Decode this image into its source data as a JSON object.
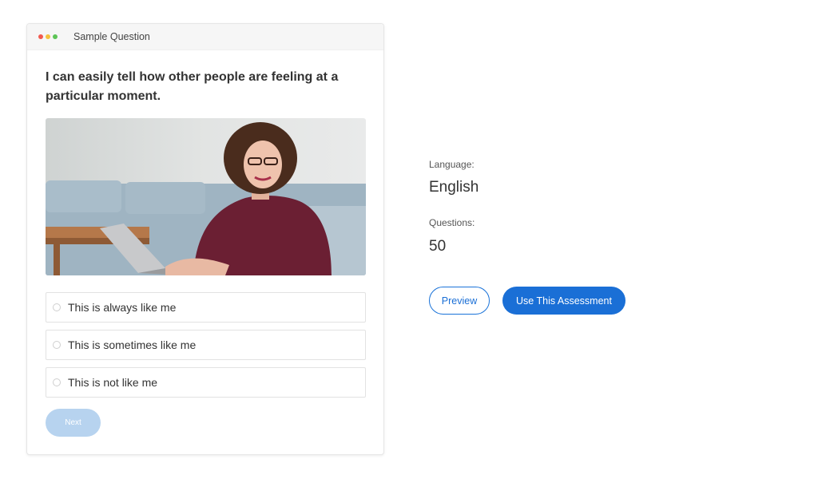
{
  "window": {
    "title": "Sample Question",
    "dot_colors": [
      "#f25a4f",
      "#f5c23e",
      "#5cc456"
    ]
  },
  "question": {
    "text": "I can easily tell how other people are feeling at a particular moment.",
    "image_icon": "woman-at-laptop-photo",
    "options": [
      "This is always like me",
      "This is sometimes like me",
      "This is not like me"
    ],
    "next_label": "Next"
  },
  "details": {
    "language_label": "Language:",
    "language_value": "English",
    "questions_label": "Questions:",
    "questions_value": "50"
  },
  "actions": {
    "preview_label": "Preview",
    "use_label": "Use This Assessment"
  },
  "colors": {
    "accent": "#1a6fd6",
    "next_disabled": "#b7d3ef"
  }
}
